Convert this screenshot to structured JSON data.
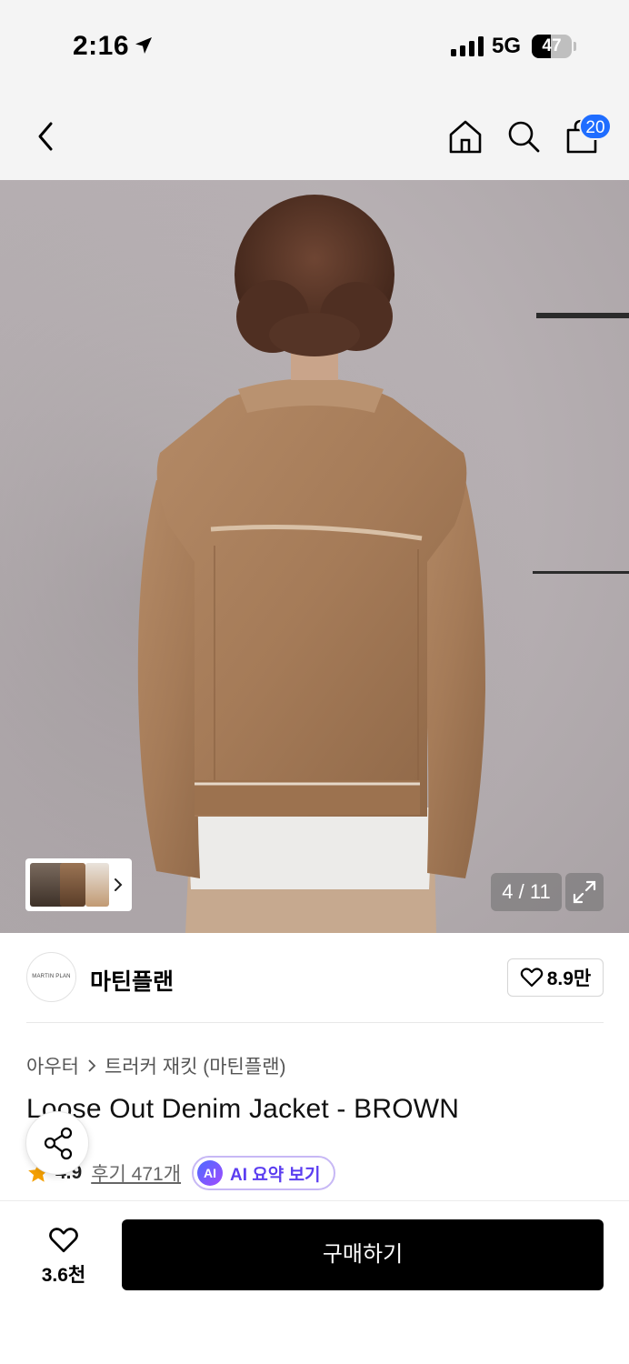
{
  "status_bar": {
    "time": "2:16",
    "network": "5G",
    "battery": "47",
    "battery_level": 0.47,
    "icons": [
      "location-arrow-icon",
      "signal-icon",
      "battery-icon"
    ]
  },
  "nav": {
    "icons": [
      "back-icon",
      "home-icon",
      "search-icon",
      "shopping-bag-icon"
    ],
    "cart_count": "20"
  },
  "gallery": {
    "counter": "4 / 11",
    "icons": [
      "chevron-right-icon",
      "expand-icon"
    ]
  },
  "brand": {
    "logo_text": "MARTIN PLAN",
    "name": "마틴플랜",
    "like_count": "8.9만"
  },
  "product": {
    "breadcrumb_category": "아우터",
    "breadcrumb_sub": "트러커 재킷 (마틴플랜)",
    "title": "Loose Out Denim Jacket - BROWN",
    "rating": "4.9",
    "reviews": "후기 471개",
    "ai_badge": "AI",
    "ai_label": "AI 요약 보기"
  },
  "bottom_bar": {
    "wish_count": "3.6천",
    "buy_label": "구매하기"
  },
  "colors": {
    "accent_blue": "#1f6dff",
    "ai_purple": "#5b3df0",
    "star": "#f5a000",
    "buy_button": "#000000"
  }
}
